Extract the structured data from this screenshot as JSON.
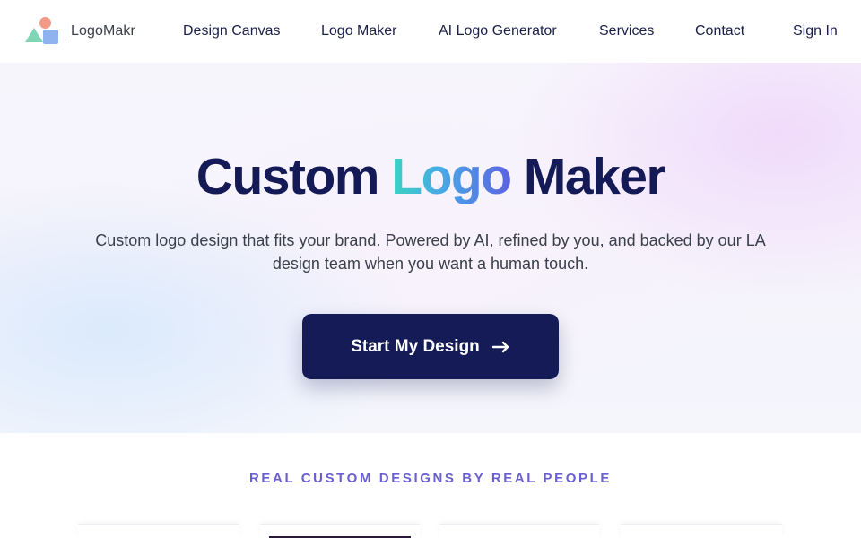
{
  "header": {
    "logo_text": "LogoMakr",
    "nav": [
      {
        "label": "Design Canvas"
      },
      {
        "label": "Logo Maker"
      },
      {
        "label": "AI Logo Generator"
      },
      {
        "label": "Services"
      },
      {
        "label": "Contact"
      }
    ],
    "sign_in": "Sign In"
  },
  "hero": {
    "title_part1": "Custom ",
    "title_accent": "Logo",
    "title_part2": " Maker",
    "subtitle": "Custom logo design that fits your brand. Powered by AI, refined by you, and backed by our LA design team when you want a human touch.",
    "cta_label": "Start My Design"
  },
  "section": {
    "heading": "REAL CUSTOM DESIGNS BY REAL PEOPLE"
  },
  "colors": {
    "brand_navy": "#141b56",
    "accent_purple": "#6a5fd0",
    "gradient_start": "#3ad4c4",
    "gradient_end": "#5b62e0"
  },
  "icons": {
    "logo": "logomakr-shapes-icon",
    "cta": "arrow-right-icon"
  }
}
